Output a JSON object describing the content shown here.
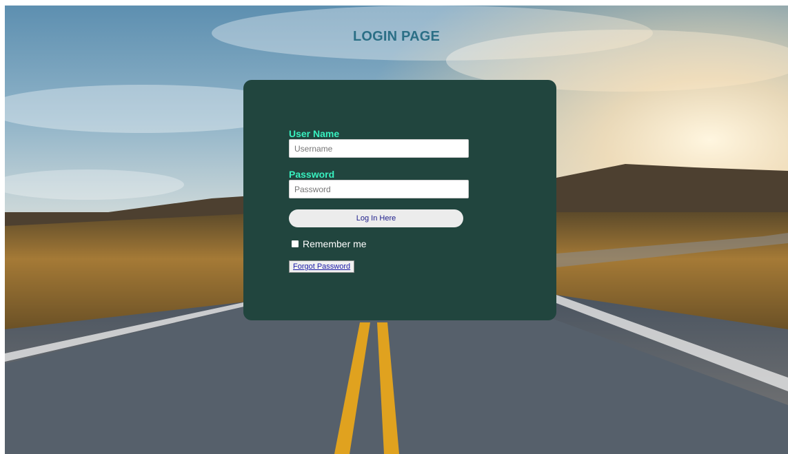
{
  "page": {
    "title": "LOGIN PAGE"
  },
  "form": {
    "username_label": "User Name",
    "username_placeholder": "Username",
    "username_value": "",
    "password_label": "Password",
    "password_placeholder": "Password",
    "password_value": "",
    "login_button": "Log In Here",
    "remember_label": "Remember me",
    "remember_checked": false,
    "forgot_button": "Forgot Password"
  },
  "colors": {
    "title": "#2b6f86",
    "card": "#21453e",
    "label_accent": "#38f0bf",
    "button_text": "#1b1b8a"
  }
}
